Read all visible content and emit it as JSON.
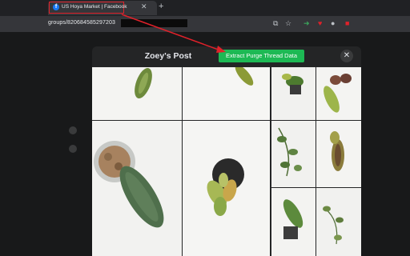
{
  "browser": {
    "tab_title": "US Hoya Market | Facebook",
    "tab_favicon": "f",
    "tab_close": "✕",
    "new_tab": "+",
    "url": "groups/820684585297203"
  },
  "modal": {
    "title": "Zoey's Post",
    "extract_button": "Extract Purge Thread Data",
    "close": "✕"
  },
  "colors": {
    "accent_green": "#1db954",
    "annotation_red": "#e0212a",
    "facebook_blue": "#1877f2"
  },
  "icons": [
    "share-icon",
    "star-icon",
    "extension-icon",
    "shield-icon",
    "profile-icon"
  ]
}
